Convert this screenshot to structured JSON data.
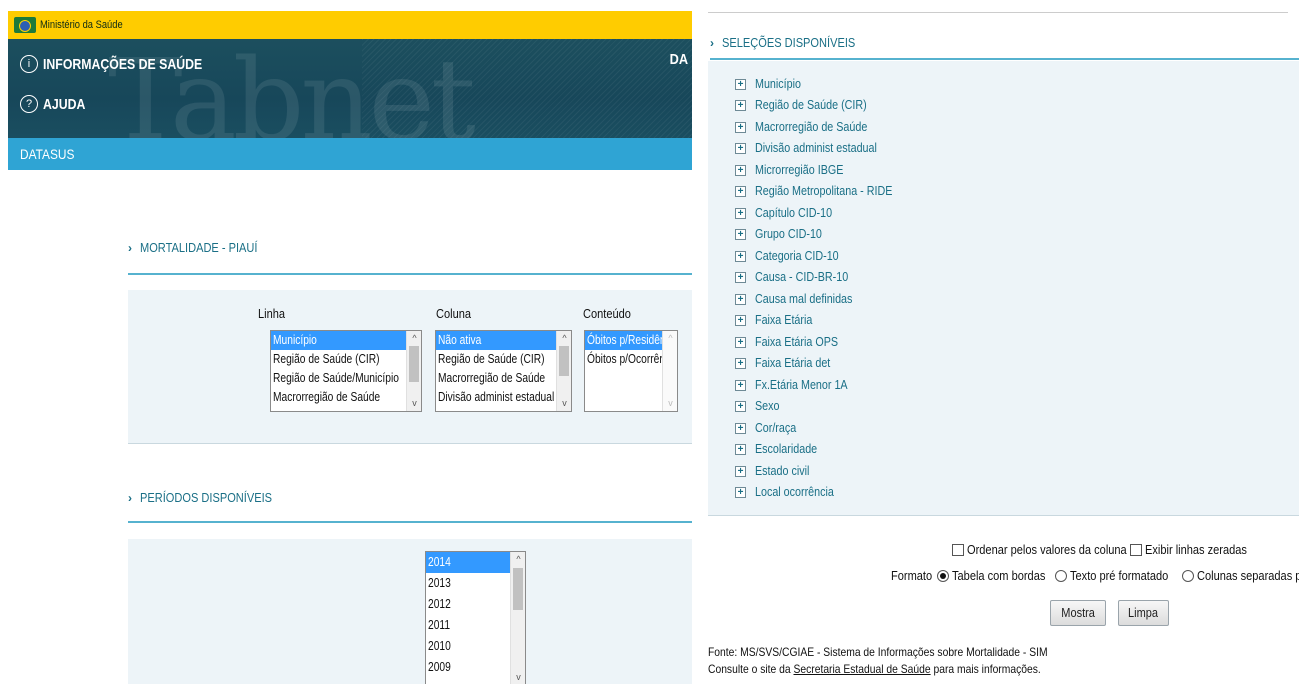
{
  "header": {
    "gov_label": "Ministério da Saúde",
    "nav": [
      {
        "icon": "info-icon",
        "glyph": "i",
        "label": "INFORMAÇÕES DE SAÚDE"
      },
      {
        "icon": "help-icon",
        "glyph": "?",
        "label": "AJUDA"
      }
    ],
    "watermark": "Tabnet",
    "cut_text": "DA",
    "datasus_label": "DATASUS"
  },
  "mortalidade": {
    "title": "MORTALIDADE - PIAUÍ",
    "linha": {
      "label": "Linha",
      "options": [
        "Município",
        "Região de Saúde (CIR)",
        "Região de Saúde/Município",
        "Macrorregião de Saúde"
      ],
      "selected": 0
    },
    "coluna": {
      "label": "Coluna",
      "options": [
        "Não ativa",
        "Região de Saúde (CIR)",
        "Macrorregião de Saúde",
        "Divisão administ estadual"
      ],
      "selected": 0
    },
    "conteudo": {
      "label": "Conteúdo",
      "options": [
        "Óbitos p/Residênc",
        "Óbitos p/Ocorrênc"
      ],
      "selected": 0
    }
  },
  "periodos": {
    "title": "PERÍODOS DISPONÍVEIS",
    "options": [
      "2014",
      "2013",
      "2012",
      "2011",
      "2010",
      "2009"
    ],
    "selected": 0
  },
  "selecoes": {
    "title": "SELEÇÕES DISPONÍVEIS",
    "items": [
      "Município",
      "Região de Saúde (CIR)",
      "Macrorregião de Saúde",
      "Divisão administ estadual",
      "Microrregião IBGE",
      "Região Metropolitana - RIDE",
      "Capítulo CID-10",
      "Grupo CID-10",
      "Categoria CID-10",
      "Causa - CID-BR-10",
      "Causa mal definidas",
      "Faixa Etária",
      "Faixa Etária OPS",
      "Faixa Etária det",
      "Fx.Etária Menor 1A",
      "Sexo",
      "Cor/raça",
      "Escolaridade",
      "Estado civil",
      "Local ocorrência"
    ]
  },
  "options": {
    "ordenar": "Ordenar pelos valores da coluna",
    "exibir": "Exibir linhas zeradas",
    "formato_label": "Formato",
    "formatos": [
      "Tabela com bordas",
      "Texto pré formatado",
      "Colunas separadas por \";\""
    ],
    "formato_selected": 0
  },
  "buttons": {
    "mostra": "Mostra",
    "limpa": "Limpa"
  },
  "footer": {
    "fonte": "Fonte: MS/SVS/CGIAE - Sistema de Informações sobre Mortalidade - SIM",
    "consulte_pre": "Consulte o site da ",
    "consulte_link": "Secretaria Estadual de Saúde",
    "consulte_post": " para mais informações."
  }
}
